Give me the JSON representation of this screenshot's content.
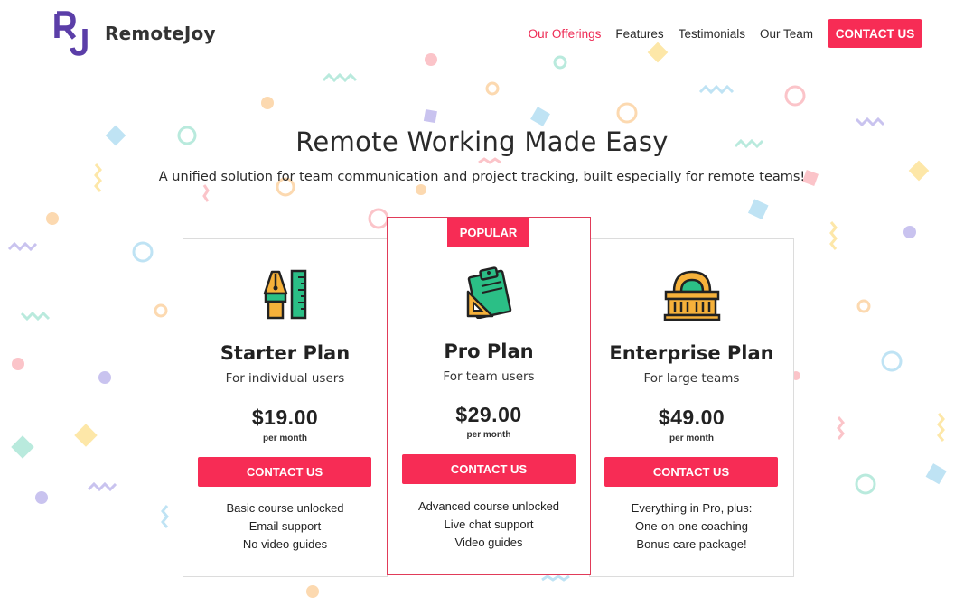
{
  "brand": {
    "name": "RemoteJoy",
    "logo_icon": "rj-monogram-icon",
    "logo_color": "#5b3ea8"
  },
  "nav": {
    "links": [
      {
        "label": "Our Offerings",
        "active": true
      },
      {
        "label": "Features",
        "active": false
      },
      {
        "label": "Testimonials",
        "active": false
      },
      {
        "label": "Our Team",
        "active": false
      }
    ],
    "cta_label": "CONTACT US"
  },
  "hero": {
    "title": "Remote Working Made Easy",
    "subtitle": "A unified solution for team communication and project tracking, built especially for remote teams!"
  },
  "plans": {
    "starter": {
      "icon": "pen-and-ruler-icon",
      "name": "Starter Plan",
      "audience": "For individual users",
      "price": "$19.00",
      "period": "per month",
      "button_label": "CONTACT US",
      "features": [
        "Basic course unlocked",
        "Email support",
        "No video guides"
      ]
    },
    "pro": {
      "badge": "POPULAR",
      "icon": "clipboard-and-set-square-icon",
      "name": "Pro Plan",
      "audience": "For team users",
      "price": "$29.00",
      "period": "per month",
      "button_label": "CONTACT US",
      "features": [
        "Advanced course unlocked",
        "Live chat support",
        "Video guides"
      ]
    },
    "enterprise": {
      "icon": "building-icon",
      "name": "Enterprise Plan",
      "audience": "For large teams",
      "price": "$49.00",
      "period": "per month",
      "button_label": "CONTACT US",
      "features": [
        "Everything in Pro, plus:",
        "One-on-one coaching",
        "Bonus care package!"
      ]
    }
  },
  "colors": {
    "accent": "#f72c55",
    "active_nav": "#ee2b55",
    "popular_border": "#e13b59",
    "confetti": [
      "#fbc4c9",
      "#fcd9b0",
      "#b9eadd",
      "#c9c3ef",
      "#bfe3f4",
      "#fde7a8"
    ]
  }
}
